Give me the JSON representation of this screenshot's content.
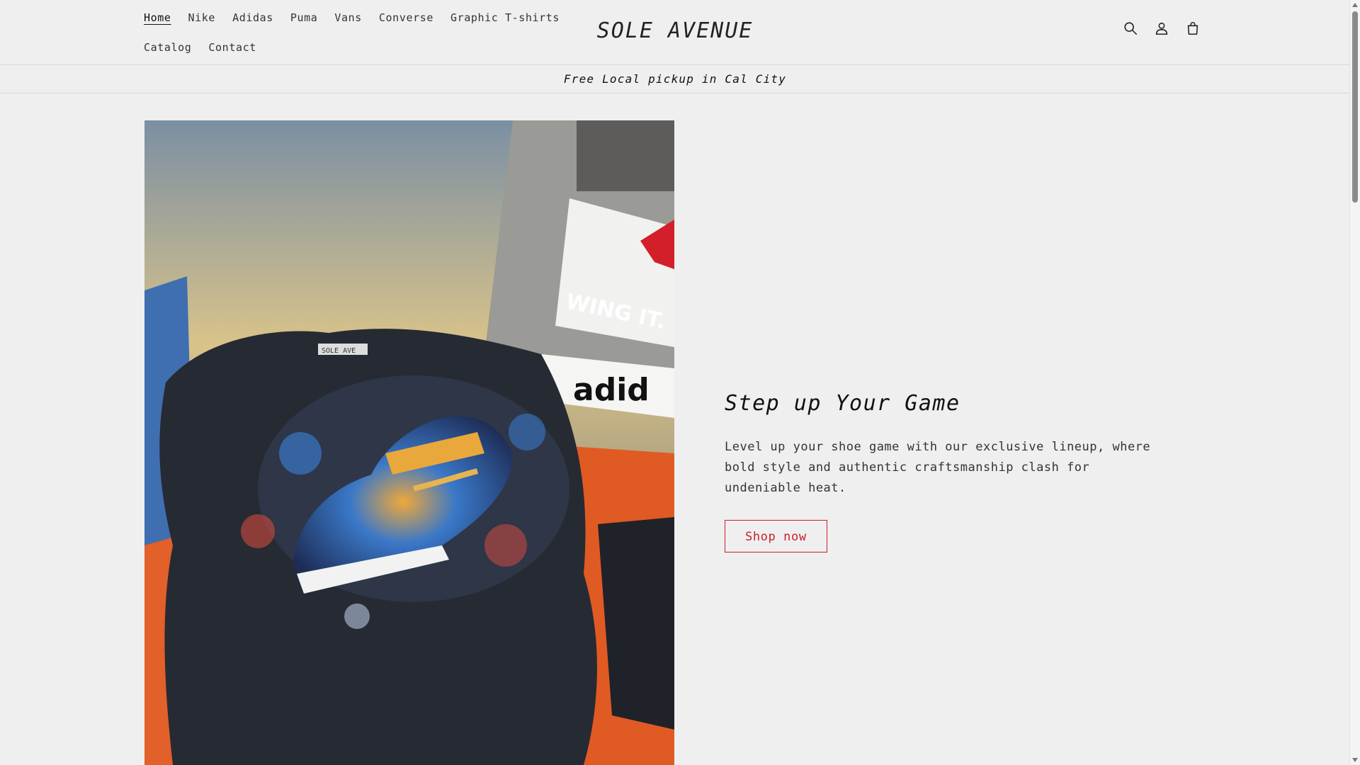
{
  "header": {
    "logo": "SOLE AVENUE",
    "nav_row1": [
      {
        "label": "Home",
        "active": true
      },
      {
        "label": "Nike"
      },
      {
        "label": "Adidas"
      },
      {
        "label": "Puma"
      },
      {
        "label": "Vans"
      },
      {
        "label": "Converse"
      },
      {
        "label": "Graphic T-shirts"
      }
    ],
    "nav_row2": [
      {
        "label": "Catalog"
      },
      {
        "label": "Contact"
      }
    ],
    "icons": [
      "search-icon",
      "account-icon",
      "cart-icon"
    ]
  },
  "announcement": {
    "text": "Free Local pickup in Cal City"
  },
  "hero": {
    "title": "Step up Your Game",
    "description": "Level up your shoe game with our exclusive lineup, where bold style and authentic craftsmanship clash for undeniable heat.",
    "button_label": "Shop now",
    "image_text": {
      "poster_caption": "WING IT.",
      "box_brand": "adid",
      "shirt_tag": "SOLE AVE"
    }
  },
  "colors": {
    "background": "#efefef",
    "accent": "#c8202a",
    "text": "#222222",
    "border": "#d8d8d8"
  }
}
